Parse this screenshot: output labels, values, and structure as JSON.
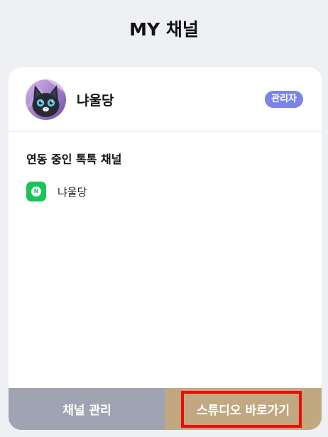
{
  "header": {
    "title": "MY 채널"
  },
  "channel": {
    "name": "냐울당",
    "role_badge": "관리자"
  },
  "linked": {
    "section_title": "연동 중인 톡톡 채널",
    "items": [
      {
        "name": "냐울당",
        "icon": "naver-talktalk-icon"
      }
    ]
  },
  "footer": {
    "manage_label": "채널 관리",
    "studio_label": "스튜디오 바로가기"
  },
  "colors": {
    "background": "#eef0f4",
    "badge": "#7a83e8",
    "manage_button": "#a0a3b1",
    "studio_button": "#c2a880",
    "highlight": "#ee0b0b",
    "talktalk_green": "#19c45a"
  }
}
